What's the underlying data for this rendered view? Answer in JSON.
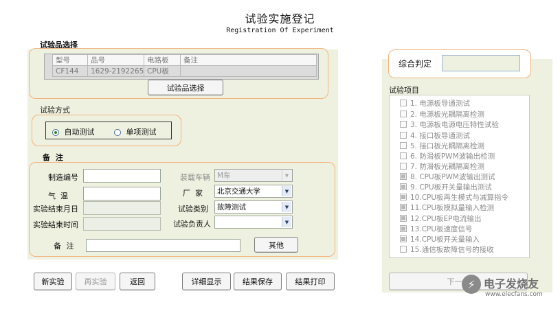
{
  "header": {
    "title": "试验实施登记",
    "subtitle": "Registration Of Experiment"
  },
  "sample_section": {
    "label": "试验品选择",
    "columns": [
      "型号",
      "品号",
      "电路板",
      "备注"
    ],
    "row": [
      "CF144",
      "1629-21922656-",
      "CPU板",
      ""
    ],
    "select_button": "试验品选择"
  },
  "mode_section": {
    "label": "试验方式",
    "options": [
      {
        "label": "自动测试",
        "selected": true
      },
      {
        "label": "单项测试",
        "selected": false
      }
    ]
  },
  "notes_section": {
    "label": "备 注",
    "serial_label": "制造编号",
    "serial_value": "",
    "temp_label": "气  温",
    "temp_value": "",
    "end_date_label": "实验结束月日",
    "end_time_label": "实验结束时间",
    "vehicle_label": "装载车辆",
    "vehicle_value": "M车",
    "factory_label": "厂  家",
    "factory_value": "北京交通大学",
    "test_type_label": "试验类别",
    "test_type_value": "故障测试",
    "owner_label": "试验负责人",
    "owner_value": "",
    "remark_label": "备 注",
    "remark_value": "",
    "other_button": "其他"
  },
  "judgement": {
    "label": "综合判定",
    "value": ""
  },
  "test_items": {
    "label": "试验项目",
    "items": [
      {
        "text": "1.  电源板导通测试",
        "checked": false
      },
      {
        "text": "2.  电源板光耦隔离检测",
        "checked": false
      },
      {
        "text": "3.  电源板电源电压特性试验",
        "checked": false
      },
      {
        "text": "4.  接口板导通测试",
        "checked": false
      },
      {
        "text": "5.  接口板光耦隔离检测",
        "checked": false
      },
      {
        "text": "6.  防滑板PWM波输出检测",
        "checked": false
      },
      {
        "text": "7.  防滑板光耦隔离检测",
        "checked": false
      },
      {
        "text": "8.  CPU板PWM波输出测试",
        "checked": true
      },
      {
        "text": "9.  CPU板开关量输出测试",
        "checked": true
      },
      {
        "text": "10.CPU板再生模式与减算指令",
        "checked": true
      },
      {
        "text": "11.CPU板模拟量输入检测",
        "checked": true
      },
      {
        "text": "12.CPU板EP电流输出",
        "checked": true
      },
      {
        "text": "13.CPU板速度信号",
        "checked": true
      },
      {
        "text": "14.CPU板开关量输入",
        "checked": true
      },
      {
        "text": "15.通信板故障信号的接收",
        "checked": false
      }
    ]
  },
  "bottom_buttons": {
    "new": "新实验",
    "redo": "再实验",
    "back": "返回",
    "detail": "详细显示",
    "save": "结果保存",
    "print": "结果打印",
    "next": "下一步"
  },
  "watermark": {
    "text": "电子发烧友",
    "url": "www.elecfans.com"
  }
}
